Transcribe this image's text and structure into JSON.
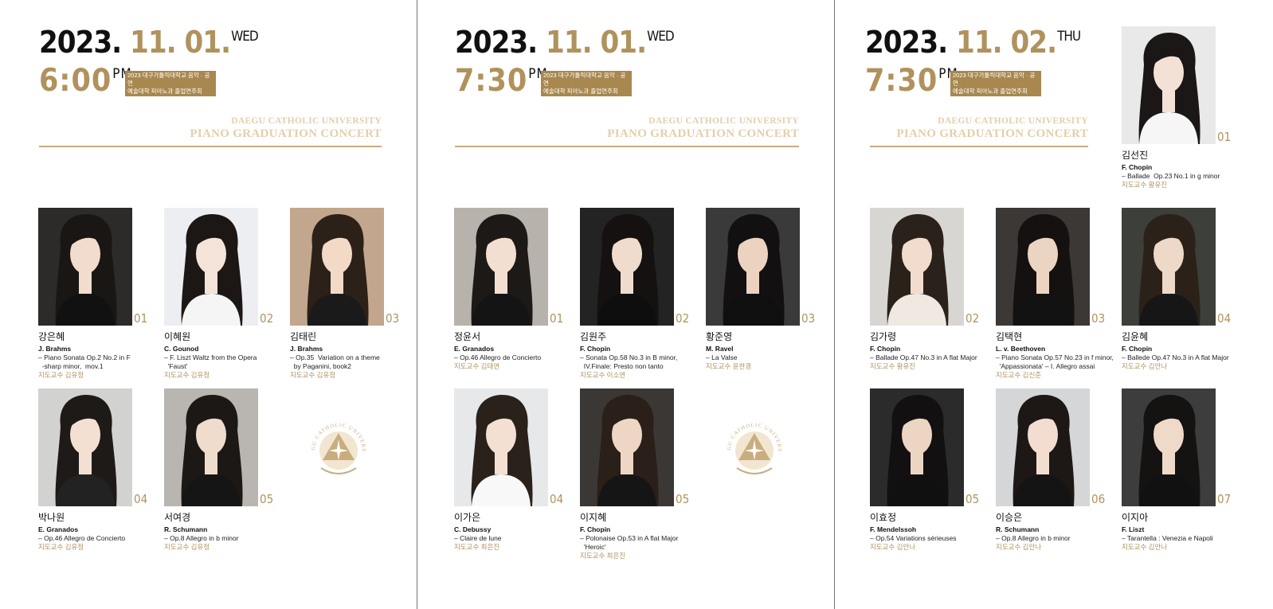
{
  "panels": [
    {
      "date_year": "2023.",
      "date_md": "11. 01.",
      "dow": "WED",
      "time": "6:00",
      "ampm": "PM",
      "tag_line1": "2023 대구가톨릭대학교 음악 · 공연",
      "tag_line2": "예술대학 피아노과 졸업연주회",
      "uni_line1": "DAEGU CATHOLIC UNIVERSITY",
      "uni_line2": "PIANO GRADUATION CONCERT",
      "seal_text": "DAEGU CATHOLIC UNIVERSITY",
      "performers": [
        {
          "num": "01",
          "name": "강은혜",
          "composer": "J. Brahms",
          "work": "– Piano Sonata Op.2 No.2 in F\n  -sharp minor,  mov.1",
          "professor": "지도교수 김유정",
          "bg": "#2d2b2a",
          "skin": "#f1dccd",
          "hair": "#1a1614",
          "outfit": "#111111"
        },
        {
          "num": "02",
          "name": "이혜원",
          "composer": "C. Gounod",
          "work": "– F. Liszt Waltz from the Opera\n  'Faust'",
          "professor": "지도교수 김유정",
          "bg": "#eceef2",
          "skin": "#f4e3d8",
          "hair": "#1c1715",
          "outfit": "#f5f5f5"
        },
        {
          "num": "03",
          "name": "김태린",
          "composer": "J. Brahms",
          "work": "– Op.35  Variation on a theme\n  by Paganini, book2",
          "professor": "지도교수 김유정",
          "bg": "#c2a68d",
          "skin": "#f2dac7",
          "hair": "#2c2119",
          "outfit": "#1a1a1a"
        },
        {
          "num": "04",
          "name": "박나원",
          "composer": "E. Granados",
          "work": "– Op.46 Allegro de Concierto",
          "professor": "지도교수 김유정",
          "bg": "#d2d2d0",
          "skin": "#f3e0d3",
          "hair": "#1e1a18",
          "outfit": "#222222"
        },
        {
          "num": "05",
          "name": "서여경",
          "composer": "R. Schumann",
          "work": "– Op.8 Allegro in b minor",
          "professor": "지도교수 김유정",
          "bg": "#b9b6b2",
          "skin": "#efdccd",
          "hair": "#1c1816",
          "outfit": "#151515"
        }
      ]
    },
    {
      "date_year": "2023.",
      "date_md": "11. 01.",
      "dow": "WED",
      "time": "7:30",
      "ampm": "PM",
      "tag_line1": "2023 대구가톨릭대학교 음악 · 공연",
      "tag_line2": "예술대학 피아노과 졸업연주회",
      "uni_line1": "DAEGU CATHOLIC UNIVERSITY",
      "uni_line2": "PIANO GRADUATION CONCERT",
      "seal_text": "DAEGU CATHOLIC UNIVERSITY",
      "performers": [
        {
          "num": "01",
          "name": "정윤서",
          "composer": "E. Granados",
          "work": "– Op.46 Allegro de Concierto",
          "professor": "지도교수 김태연",
          "bg": "#b7b2ab",
          "skin": "#f3dfd1",
          "hair": "#1d1917",
          "outfit": "#141414"
        },
        {
          "num": "02",
          "name": "김원주",
          "composer": "F. Chopin",
          "work": "– Sonata Op.58 No.3 in B minor,\n  IV.Finale: Presto non tanto",
          "professor": "지도교수 이소연",
          "bg": "#232323",
          "skin": "#f0dccd",
          "hair": "#141110",
          "outfit": "#0e0e0e"
        },
        {
          "num": "03",
          "name": "황준영",
          "composer": "M. Ravel",
          "work": "– La Valse",
          "professor": "지도교수 윤한경",
          "bg": "#3a3a3a",
          "skin": "#ecd3c0",
          "hair": "#121010",
          "outfit": "#0f0f0f"
        },
        {
          "num": "04",
          "name": "이가은",
          "composer": "C. Debussy",
          "work": "– Claire de lune",
          "professor": "지도교수 최은진",
          "bg": "#e6e8ea",
          "skin": "#f3e0d3",
          "hair": "#2a211b",
          "outfit": "#f8f8f8"
        },
        {
          "num": "05",
          "name": "이지혜",
          "composer": "F. Chopin",
          "work": "– Polonaise Op.53 in A flat Major\n  'Heroic'",
          "professor": "지도교수 최은진",
          "bg": "#3b3734",
          "skin": "#eed6c4",
          "hair": "#2a1f19",
          "outfit": "#151515"
        }
      ]
    },
    {
      "date_year": "2023.",
      "date_md": "11. 02.",
      "dow": "THU",
      "time": "7:30",
      "ampm": "PM",
      "tag_line1": "2023 대구가톨릭대학교 음악 · 공연",
      "tag_line2": "예술대학 피아노과 졸업연주회",
      "uni_line1": "DAEGU CATHOLIC UNIVERSITY",
      "uni_line2": "PIANO GRADUATION CONCERT",
      "performers": [
        {
          "num": "01",
          "name": "김선진",
          "composer": "F. Chopin",
          "work": "– Ballade  Op.23 No.1 in g minor",
          "professor": "지도교수 황유진",
          "bg": "#e9e9e9",
          "skin": "#f3e1d5",
          "hair": "#1b1716",
          "outfit": "#f6f6f6"
        },
        {
          "num": "02",
          "name": "김가령",
          "composer": "F. Chopin",
          "work": "– Ballade Op.47 No.3 in A flat Major",
          "professor": "지도교수 황유진",
          "bg": "#d8d6d3",
          "skin": "#f1dccd",
          "hair": "#2a211b",
          "outfit": "#efe9e2"
        },
        {
          "num": "03",
          "name": "김택현",
          "composer": "L. v. Beethoven",
          "work": "– Piano Sonata Op.57 No.23 in f minor,\n  'Appassionata' – I. Allegro assai",
          "professor": "지도교수 김신준",
          "bg": "#3b3836",
          "skin": "#ecd4c2",
          "hair": "#141110",
          "outfit": "#121212"
        },
        {
          "num": "04",
          "name": "김윤혜",
          "composer": "F. Chopin",
          "work": "– Ballede Op.47 No.3 in A flat Major",
          "professor": "지도교수 김안나",
          "bg": "#3c3f3a",
          "skin": "#eed8c7",
          "hair": "#2b2119",
          "outfit": "#161616"
        },
        {
          "num": "05",
          "name": "이효정",
          "composer": "F. Mendelssoh",
          "work": "– Op.54 Variations sérieuses",
          "professor": "지도교수 김안나",
          "bg": "#2b2b2b",
          "skin": "#ecd5c3",
          "hair": "#121010",
          "outfit": "#101010"
        },
        {
          "num": "06",
          "name": "이승은",
          "composer": "R. Schumann",
          "work": "– Op.8 Allegro in b minor",
          "professor": "지도교수 김안나",
          "bg": "#d5d6d8",
          "skin": "#f2ddd0",
          "hair": "#1d1816",
          "outfit": "#141414"
        },
        {
          "num": "07",
          "name": "이지아",
          "composer": "F. Liszt",
          "work": "– Tarantella : Venezia e Napoli",
          "professor": "지도교수 김안나",
          "bg": "#3d3d3d",
          "skin": "#efd9c9",
          "hair": "#151212",
          "outfit": "#111111"
        }
      ]
    }
  ],
  "colors": {
    "accent": "#b0925d",
    "tag_bg": "#a8884f",
    "uni_text": "#e3cfaa",
    "rule": "#c9ad7e"
  }
}
